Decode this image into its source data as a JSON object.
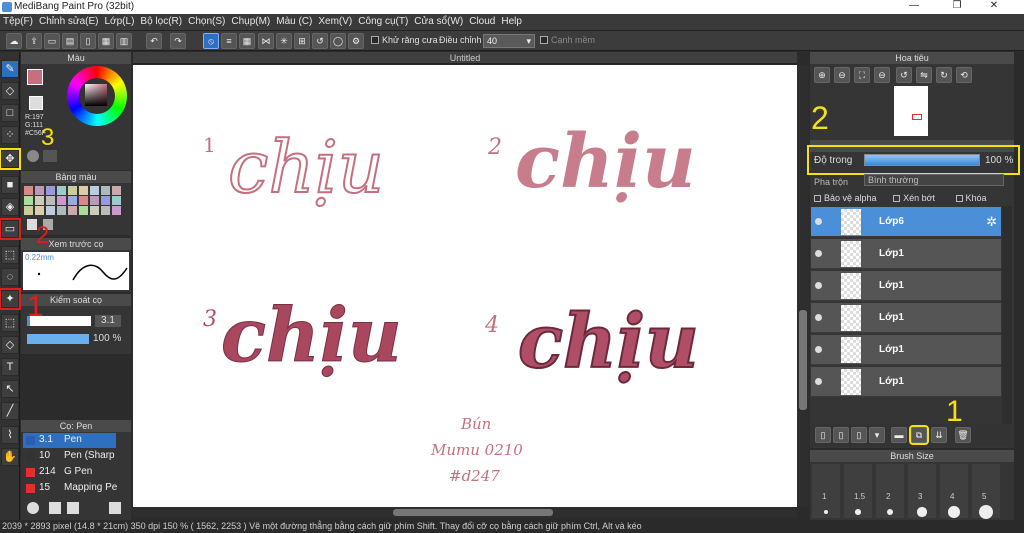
{
  "window": {
    "title": "MediBang Paint Pro (32bit)",
    "minimize": "—",
    "maximize": "❐",
    "close": "✕"
  },
  "menu": [
    "Tệp(F)",
    "Chỉnh sửa(E)",
    "Lớp(L)",
    "Bộ lọc(R)",
    "Chọn(S)",
    "Chụp(M)",
    "Màu (C)",
    "Xem(V)",
    "Công cụ(T)",
    "Cửa sổ(W)",
    "Cloud",
    "Help"
  ],
  "toolbar": {
    "antialias_label": "Khử răng cưa",
    "correction_label": "Điều chỉnh",
    "correction_value": "40",
    "edge_label": "Cạnh mềm"
  },
  "color_panel": {
    "title": "Màu",
    "r": "R:197",
    "g": "G:111",
    "hex": "#C56F"
  },
  "palette_panel": {
    "title": "Bảng màu"
  },
  "brush_preview": {
    "title": "Xem trước cọ",
    "size": "0.22mm"
  },
  "brush_control": {
    "title": "Kiểm soát cọ",
    "size_value": "3.1",
    "opacity_value": "100 %"
  },
  "brush_list": {
    "title": "Cọ: Pen",
    "items": [
      {
        "size": "3.1",
        "name": "Pen",
        "color": "#2a5fb0"
      },
      {
        "size": "10",
        "name": "Pen (Sharp",
        "color": "#333333"
      },
      {
        "size": "214",
        "name": "G Pen",
        "color": "#e03030"
      },
      {
        "size": "15",
        "name": "Mapping Pe",
        "color": "#e03030"
      }
    ]
  },
  "canvas": {
    "tab_title": "Untitled",
    "numbers": [
      "1",
      "2",
      "3",
      "4"
    ],
    "word": "chịu",
    "signature": [
      "Bún",
      "Mumu 0210",
      "#d247"
    ]
  },
  "navigator": {
    "title": "Hoa tiêu"
  },
  "layer_panel": {
    "opacity_label": "Độ trong",
    "opacity_value": "100 %",
    "opacity_fraction": 1.0,
    "blend_label": "Pha trộn",
    "blend_value": "Bình thường",
    "protect_alpha": "Bảo vệ alpha",
    "clipping": "Xén bớt",
    "lock": "Khóa",
    "layers": [
      "Lớp6",
      "Lớp1",
      "Lớp1",
      "Lớp1",
      "Lớp1",
      "Lớp1"
    ]
  },
  "brush_size_panel": {
    "title": "Brush Size",
    "sizes": [
      "1",
      "1.5",
      "2",
      "3",
      "4",
      "5"
    ]
  },
  "annotations": {
    "a1_left": "1",
    "a2_left": "2",
    "a3_left": "3",
    "a1_right": "1",
    "a2_right": "2"
  },
  "status": {
    "text": "2039 * 2893 pixel   (14.8 * 21cm)   350 dpi   150 %   ( 1562, 2253 )   Vẽ một đường thẳng bằng cách giữ phím Shift. Thay đổi cỡ cọ bằng cách giữ phím Ctrl, Alt và kéo"
  },
  "colors": {
    "ink": "#c5707f",
    "accent": "#4a8fd8",
    "highlight_yellow": "#f4e10e",
    "highlight_red": "#e01c1c"
  }
}
